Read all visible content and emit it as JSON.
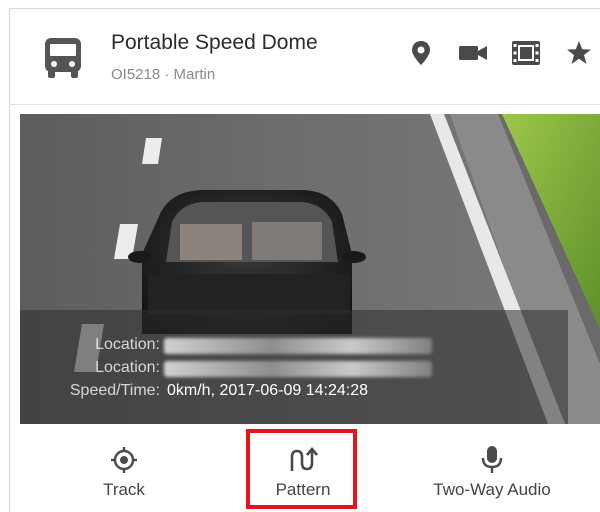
{
  "device": {
    "title": "Portable Speed Dome",
    "subtitle": "OI5218 · Martin",
    "icon": "bus-icon"
  },
  "header_actions": [
    {
      "name": "location-pin-icon"
    },
    {
      "name": "video-camera-icon"
    },
    {
      "name": "film-icon"
    },
    {
      "name": "star-icon"
    }
  ],
  "video_overlay": {
    "location_label_1": "Location:",
    "location_label_2": "Location:",
    "speed_label": "Speed/Time:",
    "speed_value": "0km/h, 2017-06-09 14:24:28"
  },
  "actions": {
    "track": {
      "label": "Track",
      "icon": "crosshair-icon"
    },
    "pattern": {
      "label": "Pattern",
      "icon": "pattern-icon"
    },
    "audio": {
      "label": "Two-Way Audio",
      "icon": "microphone-icon"
    }
  },
  "colors": {
    "highlight": "#e8141b",
    "icon": "#4a4a4a"
  }
}
